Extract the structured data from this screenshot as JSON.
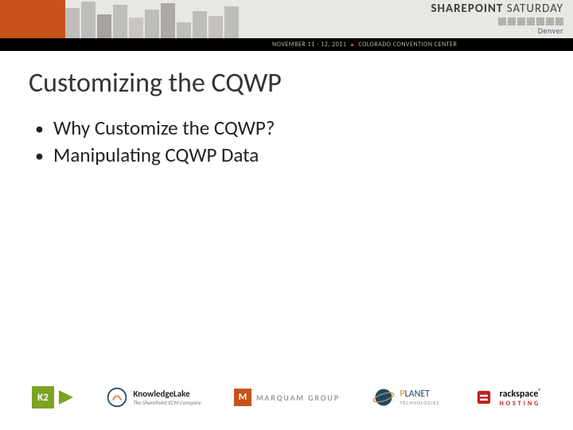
{
  "header": {
    "event_name_a": "SHAREPOINT",
    "event_name_b": "SATURDAY",
    "city": "Denver",
    "date_text": "NOVEMBER 11 - 12, 2011",
    "venue_text": "COLORADO CONVENTION CENTER"
  },
  "slide": {
    "title": "Customizing the CQWP",
    "bullets": [
      "Why Customize the CQWP?",
      "Manipulating CQWP Data"
    ]
  },
  "sponsors": {
    "k2": "K2",
    "knowledgelake": "KnowledgeLake",
    "knowledgelake_sub": "The SharePoint ECM Company",
    "marquam": "MARQUAM GROUP",
    "marquam_badge": "M",
    "planet_a": "P",
    "planet_b": "LANET",
    "planet_sub": "TECHNOLOGIES",
    "rackspace": "rackspace",
    "rackspace_reg": "®",
    "rackspace_sub": "HOSTING"
  }
}
